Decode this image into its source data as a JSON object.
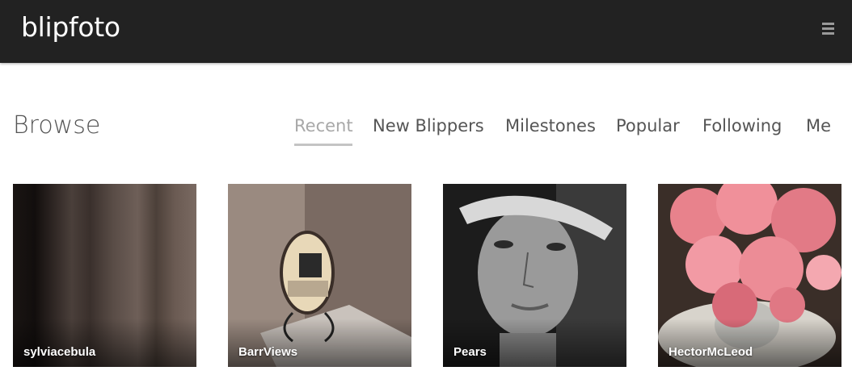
{
  "header": {
    "logo_text": "blipfoto",
    "menu_icon": "hamburger-menu-icon",
    "background_color": "#222222"
  },
  "page": {
    "title": "Browse"
  },
  "tabs": [
    {
      "label": "Recent",
      "active": true
    },
    {
      "label": "New Blippers",
      "active": false
    },
    {
      "label": "Milestones",
      "active": false
    },
    {
      "label": "Popular",
      "active": false
    },
    {
      "label": "Following",
      "active": false
    },
    {
      "label": "Me",
      "active": false
    }
  ],
  "photos": [
    {
      "username": "sylviacebula"
    },
    {
      "username": "BarrViews"
    },
    {
      "username": "Pears"
    },
    {
      "username": "HectorMcLeod"
    }
  ]
}
